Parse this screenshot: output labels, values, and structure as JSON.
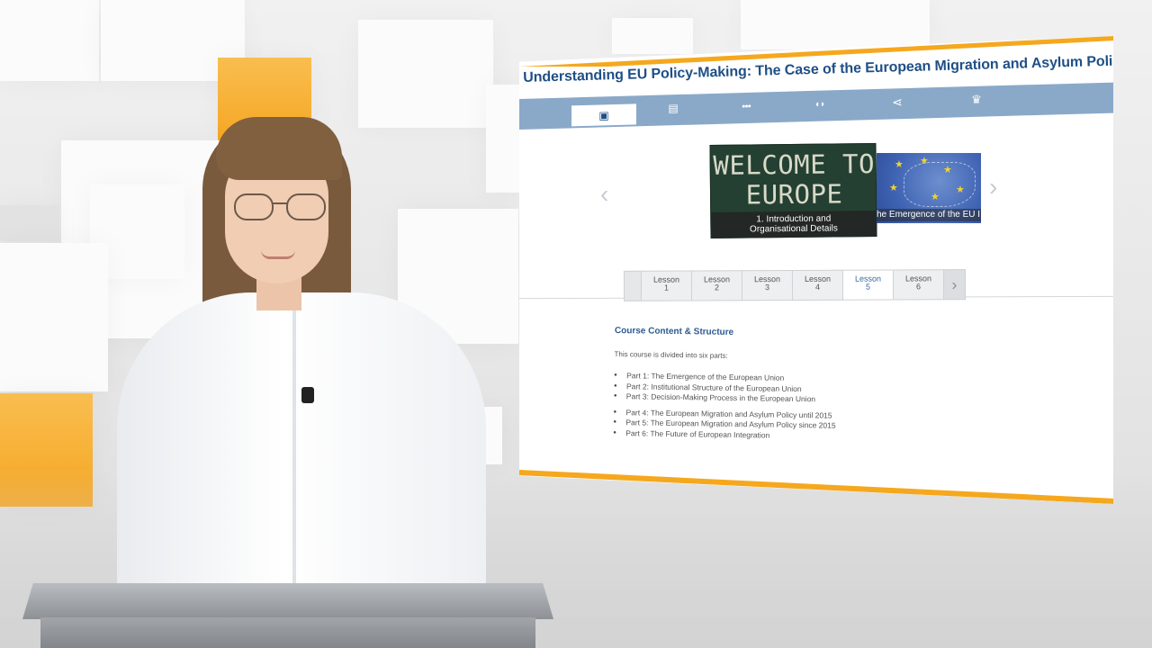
{
  "course": {
    "title": "Understanding EU Policy-Making: The Case of the European Migration and Asylum Policy"
  },
  "nav_tabs": [
    {
      "icon": "video-icon",
      "glyph": "▣",
      "active": true
    },
    {
      "icon": "news-icon",
      "glyph": "▤",
      "active": false
    },
    {
      "icon": "group-icon",
      "glyph": "●●●",
      "active": false
    },
    {
      "icon": "chat-icon",
      "glyph": "◖◗",
      "active": false
    },
    {
      "icon": "share-icon",
      "glyph": "⋖",
      "active": false
    },
    {
      "icon": "trophy-icon",
      "glyph": "♛",
      "active": false
    }
  ],
  "slider": {
    "prev_glyph": "‹",
    "next_glyph": "›",
    "main_slide": {
      "chalk_line1": "WELCOME TO",
      "chalk_line2": "EUROPE",
      "caption_line1": "1. Introduction and",
      "caption_line2": "Organisational Details"
    },
    "next_slide": {
      "caption": "he Emergence of the EU I"
    }
  },
  "lessons": [
    {
      "label": "Lesson",
      "number": "1",
      "active": false
    },
    {
      "label": "Lesson",
      "number": "2",
      "active": false
    },
    {
      "label": "Lesson",
      "number": "3",
      "active": false
    },
    {
      "label": "Lesson",
      "number": "4",
      "active": false
    },
    {
      "label": "Lesson",
      "number": "5",
      "active": true
    },
    {
      "label": "Lesson",
      "number": "6",
      "active": false
    }
  ],
  "lesson_next_glyph": "›",
  "content": {
    "heading": "Course Content & Structure",
    "intro": "This course is divided into six parts:",
    "parts": [
      "Part 1: The Emergence of the European Union",
      "Part 2: Institutional Structure of the European Union",
      "Part 3: Decision-Making Process in the European Union",
      "Part 4: The European Migration and Asylum Policy until 2015",
      "Part 5: The European Migration and Asylum Policy since 2015",
      "Part 6: The Future of European Integration"
    ]
  },
  "colors": {
    "accent_orange": "#f5a81e",
    "title_blue": "#1f4f86",
    "tabbar_blue": "#8aa9c9"
  }
}
